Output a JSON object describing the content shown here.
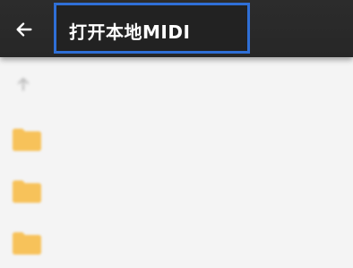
{
  "header": {
    "title": "打开本地MIDI",
    "back_icon": "arrow-left-icon"
  },
  "path_bar": {
    "icon": "up-arrow-icon"
  },
  "folders": [
    {
      "name": "",
      "icon": "folder-icon"
    },
    {
      "name": "",
      "icon": "folder-icon"
    },
    {
      "name": "",
      "icon": "folder-icon"
    }
  ],
  "colors": {
    "toolbar": "#2a2a2a",
    "highlight_border": "#2f6fd6",
    "folder": "#f7c25a",
    "background": "#f4f4f4"
  }
}
